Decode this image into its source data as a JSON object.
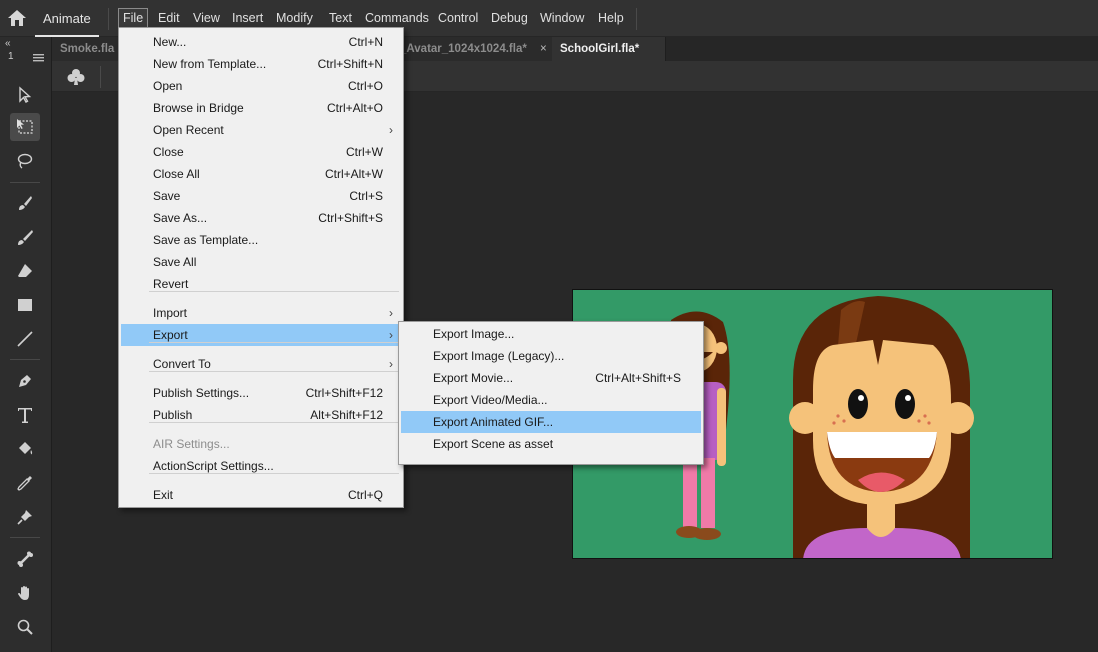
{
  "app": {
    "name": "Animate"
  },
  "menubar": {
    "items": [
      "File",
      "Edit",
      "View",
      "Insert",
      "Modify",
      "Text",
      "Commands",
      "Control",
      "Debug",
      "Window",
      "Help"
    ]
  },
  "tabs": [
    {
      "label": "Smoke.fla",
      "close": ""
    },
    {
      "label": "_Avatar_1024x1024.fla*",
      "close": "×"
    },
    {
      "label": "SchoolGirl.fla*",
      "close": "×"
    }
  ],
  "toolbar": {
    "collapse": "«",
    "number": "1"
  },
  "file_menu": {
    "items": [
      {
        "label": "New...",
        "shortcut": "Ctrl+N"
      },
      {
        "label": "New from Template...",
        "shortcut": "Ctrl+Shift+N"
      },
      {
        "label": "Open",
        "shortcut": "Ctrl+O"
      },
      {
        "label": "Browse in Bridge",
        "shortcut": "Ctrl+Alt+O"
      },
      {
        "label": "Open Recent",
        "shortcut": "",
        "submenu": "›"
      },
      {
        "label": "Close",
        "shortcut": "Ctrl+W"
      },
      {
        "label": "Close All",
        "shortcut": "Ctrl+Alt+W"
      },
      {
        "label": "Save",
        "shortcut": "Ctrl+S"
      },
      {
        "label": "Save As...",
        "shortcut": "Ctrl+Shift+S"
      },
      {
        "label": "Save as Template...",
        "shortcut": ""
      },
      {
        "label": "Save All",
        "shortcut": ""
      },
      {
        "label": "Revert",
        "shortcut": ""
      },
      {
        "label": "Import",
        "shortcut": "",
        "submenu": "›"
      },
      {
        "label": "Export",
        "shortcut": "",
        "submenu": "›"
      },
      {
        "label": "Convert To",
        "shortcut": "",
        "submenu": "›"
      },
      {
        "label": "Publish Settings...",
        "shortcut": "Ctrl+Shift+F12"
      },
      {
        "label": "Publish",
        "shortcut": "Alt+Shift+F12"
      },
      {
        "label": "AIR Settings...",
        "shortcut": ""
      },
      {
        "label": "ActionScript Settings...",
        "shortcut": ""
      },
      {
        "label": "Exit",
        "shortcut": "Ctrl+Q"
      }
    ]
  },
  "export_menu": {
    "items": [
      {
        "label": "Export Image...",
        "shortcut": ""
      },
      {
        "label": "Export Image (Legacy)...",
        "shortcut": ""
      },
      {
        "label": "Export Movie...",
        "shortcut": "Ctrl+Alt+Shift+S"
      },
      {
        "label": "Export Video/Media...",
        "shortcut": ""
      },
      {
        "label": "Export Animated GIF...",
        "shortcut": ""
      },
      {
        "label": "Export Scene as asset",
        "shortcut": ""
      }
    ]
  },
  "colors": {
    "highlight": "#91c9f7",
    "stage_bg": "#339a67",
    "skin": "#f5c27a",
    "hair": "#5a2508",
    "shirt": "#c266c9"
  },
  "icons": [
    "home-icon",
    "selection-tool-icon",
    "free-transform-tool-icon",
    "lasso-tool-icon",
    "paint-brush-icon",
    "brush-tool-icon",
    "eraser-tool-icon",
    "rectangle-tool-icon",
    "line-tool-icon",
    "pen-tool-icon",
    "text-tool-icon",
    "paint-bucket-icon",
    "eyedropper-icon",
    "pin-tool-icon",
    "bone-tool-icon",
    "hand-tool-icon",
    "zoom-tool-icon",
    "club-icon"
  ]
}
